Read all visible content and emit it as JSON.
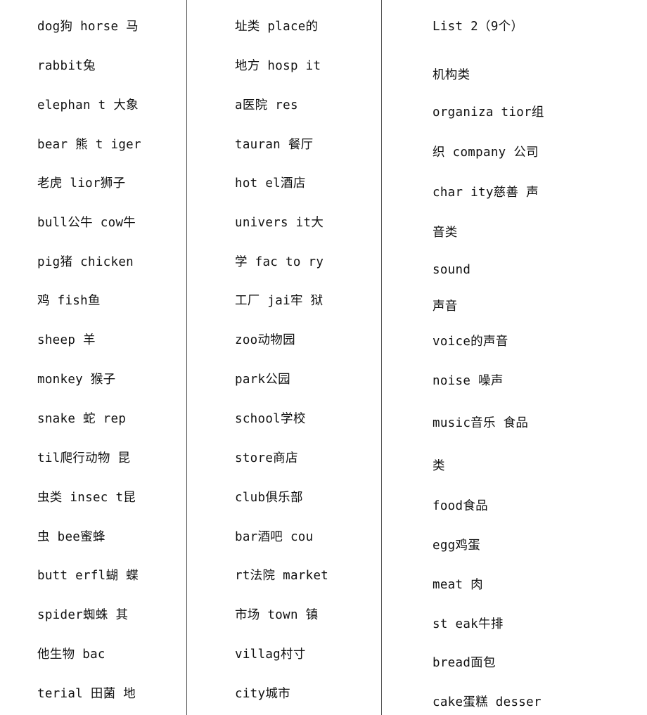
{
  "document": {
    "columns": [
      {
        "lines": [
          "dog狗 horse 马",
          "rabbit兔",
          "elephan t 大象",
          "bear 熊 t iger",
          "老虎 lior狮子",
          "bull公牛 cow牛",
          "pig猪 chicken",
          "鸡 fish鱼",
          "sheep 羊",
          "monkey 猴子",
          "snake 蛇 rep",
          "til爬行动物 昆",
          "虫类 insec t昆",
          "虫 bee蜜蜂",
          "butt erfl蝴 蝶",
          "spider蜘蛛 其",
          "他生物 bac",
          "terial 田菌 地"
        ]
      },
      {
        "lines": [
          "址类 place的",
          "地方 hosp it",
          "a医院 res",
          "tauran 餐厅",
          "hot el酒店",
          "univers it大",
          "学 fac to ry",
          "工厂 jai牢 狱",
          "zoo动物园",
          "park公园",
          "school学校",
          "store商店",
          "club俱乐部",
          "bar酒吧 cou",
          "rt法院 market",
          "市场 town 镇",
          "villag村寸",
          "city城市"
        ]
      },
      {
        "lines": [
          "List 2（9个）",
          "机构类",
          "organiza tior组",
          "织 company 公司",
          "char ity慈善 声",
          "音类",
          "sound",
          "声音",
          "voice的声音",
          "noise 噪声",
          "music音乐 食品",
          "类",
          "food食品",
          "egg鸡蛋",
          "meat 肉",
          "st eak牛排",
          "bread面包",
          "cake蛋糕 desser"
        ]
      }
    ]
  }
}
